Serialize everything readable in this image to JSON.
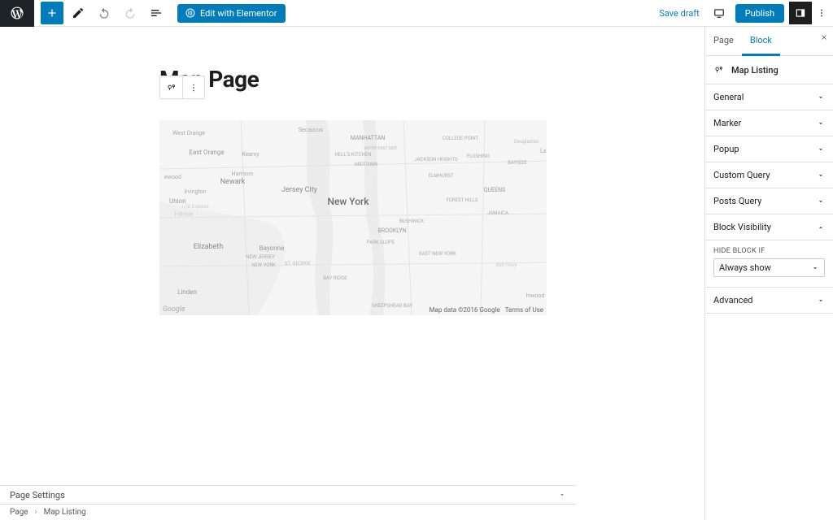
{
  "topbar": {
    "elementor_label": "Edit with Elementor",
    "save_draft_label": "Save draft",
    "publish_label": "Publish"
  },
  "canvas": {
    "page_title": "Map Page"
  },
  "map": {
    "attribution_data": "Map data ©2016 Google",
    "attribution_terms": "Terms of Use",
    "logo_text": "Google",
    "labels": {
      "new_york_big": "New York",
      "manhattan": "MANHATTAN",
      "brooklyn": "BROOKLYN",
      "queens": "QUEENS",
      "jersey_city": "Jersey City",
      "newark": "Newark",
      "elizabeth": "Elizabeth",
      "bayonne": "Bayonne",
      "linden": "Linden",
      "union": "Union",
      "east_orange": "East Orange",
      "west_orange": "West Orange",
      "kearny": "Kearny",
      "harrison": "Harrison",
      "irvington": "Irvington",
      "hillside": "Hillside",
      "college_point": "COLLEGE POINT",
      "flushing": "FLUSHING",
      "bayside": "BAYSIDE",
      "elmhurst": "ELMHURST",
      "jamaica": "JAMAICA",
      "forest_hills": "FOREST HILLS",
      "jackson_heights": "JACKSON HEIGHTS",
      "midtown": "MIDTOWN",
      "hells_kitchen": "HELL'S KITCHEN",
      "upper_east": "UPPER EAST SIDE",
      "bushwick": "BUSHWICK",
      "park_slope": "PARK SLOPE",
      "bay_ridge": "BAY RIDGE",
      "sheepshead": "SHEEPSHEAD BAY",
      "east_new_york": "EAST NEW YORK",
      "new_jersey": "NEW JERSEY",
      "new_york_sm": "NEW YORK",
      "st_george": "ST. GEORGE",
      "secaucus": "Secaucus",
      "inwood": "Inwood",
      "lak": "Lak",
      "i78": "I-78 Express",
      "ewood": "ewood",
      "belt_pkwy": "Belt Pkwy",
      "douglaston": "Douglaston"
    }
  },
  "sidebar": {
    "tabs": {
      "page": "Page",
      "block": "Block"
    },
    "block_type_label": "Map Listing",
    "panels": {
      "general": "General",
      "marker": "Marker",
      "popup": "Popup",
      "custom_query": "Custom Query",
      "posts_query": "Posts Query",
      "block_visibility": "Block Visibility",
      "advanced": "Advanced"
    },
    "visibility": {
      "field_label": "HIDE BLOCK IF",
      "select_value": "Always show"
    }
  },
  "footer": {
    "page_settings_label": "Page Settings",
    "breadcrumb": {
      "root": "Page",
      "leaf": "Map Listing"
    }
  },
  "icons": {
    "chevron_down": "chevron-down",
    "chevron_up": "chevron-up"
  }
}
